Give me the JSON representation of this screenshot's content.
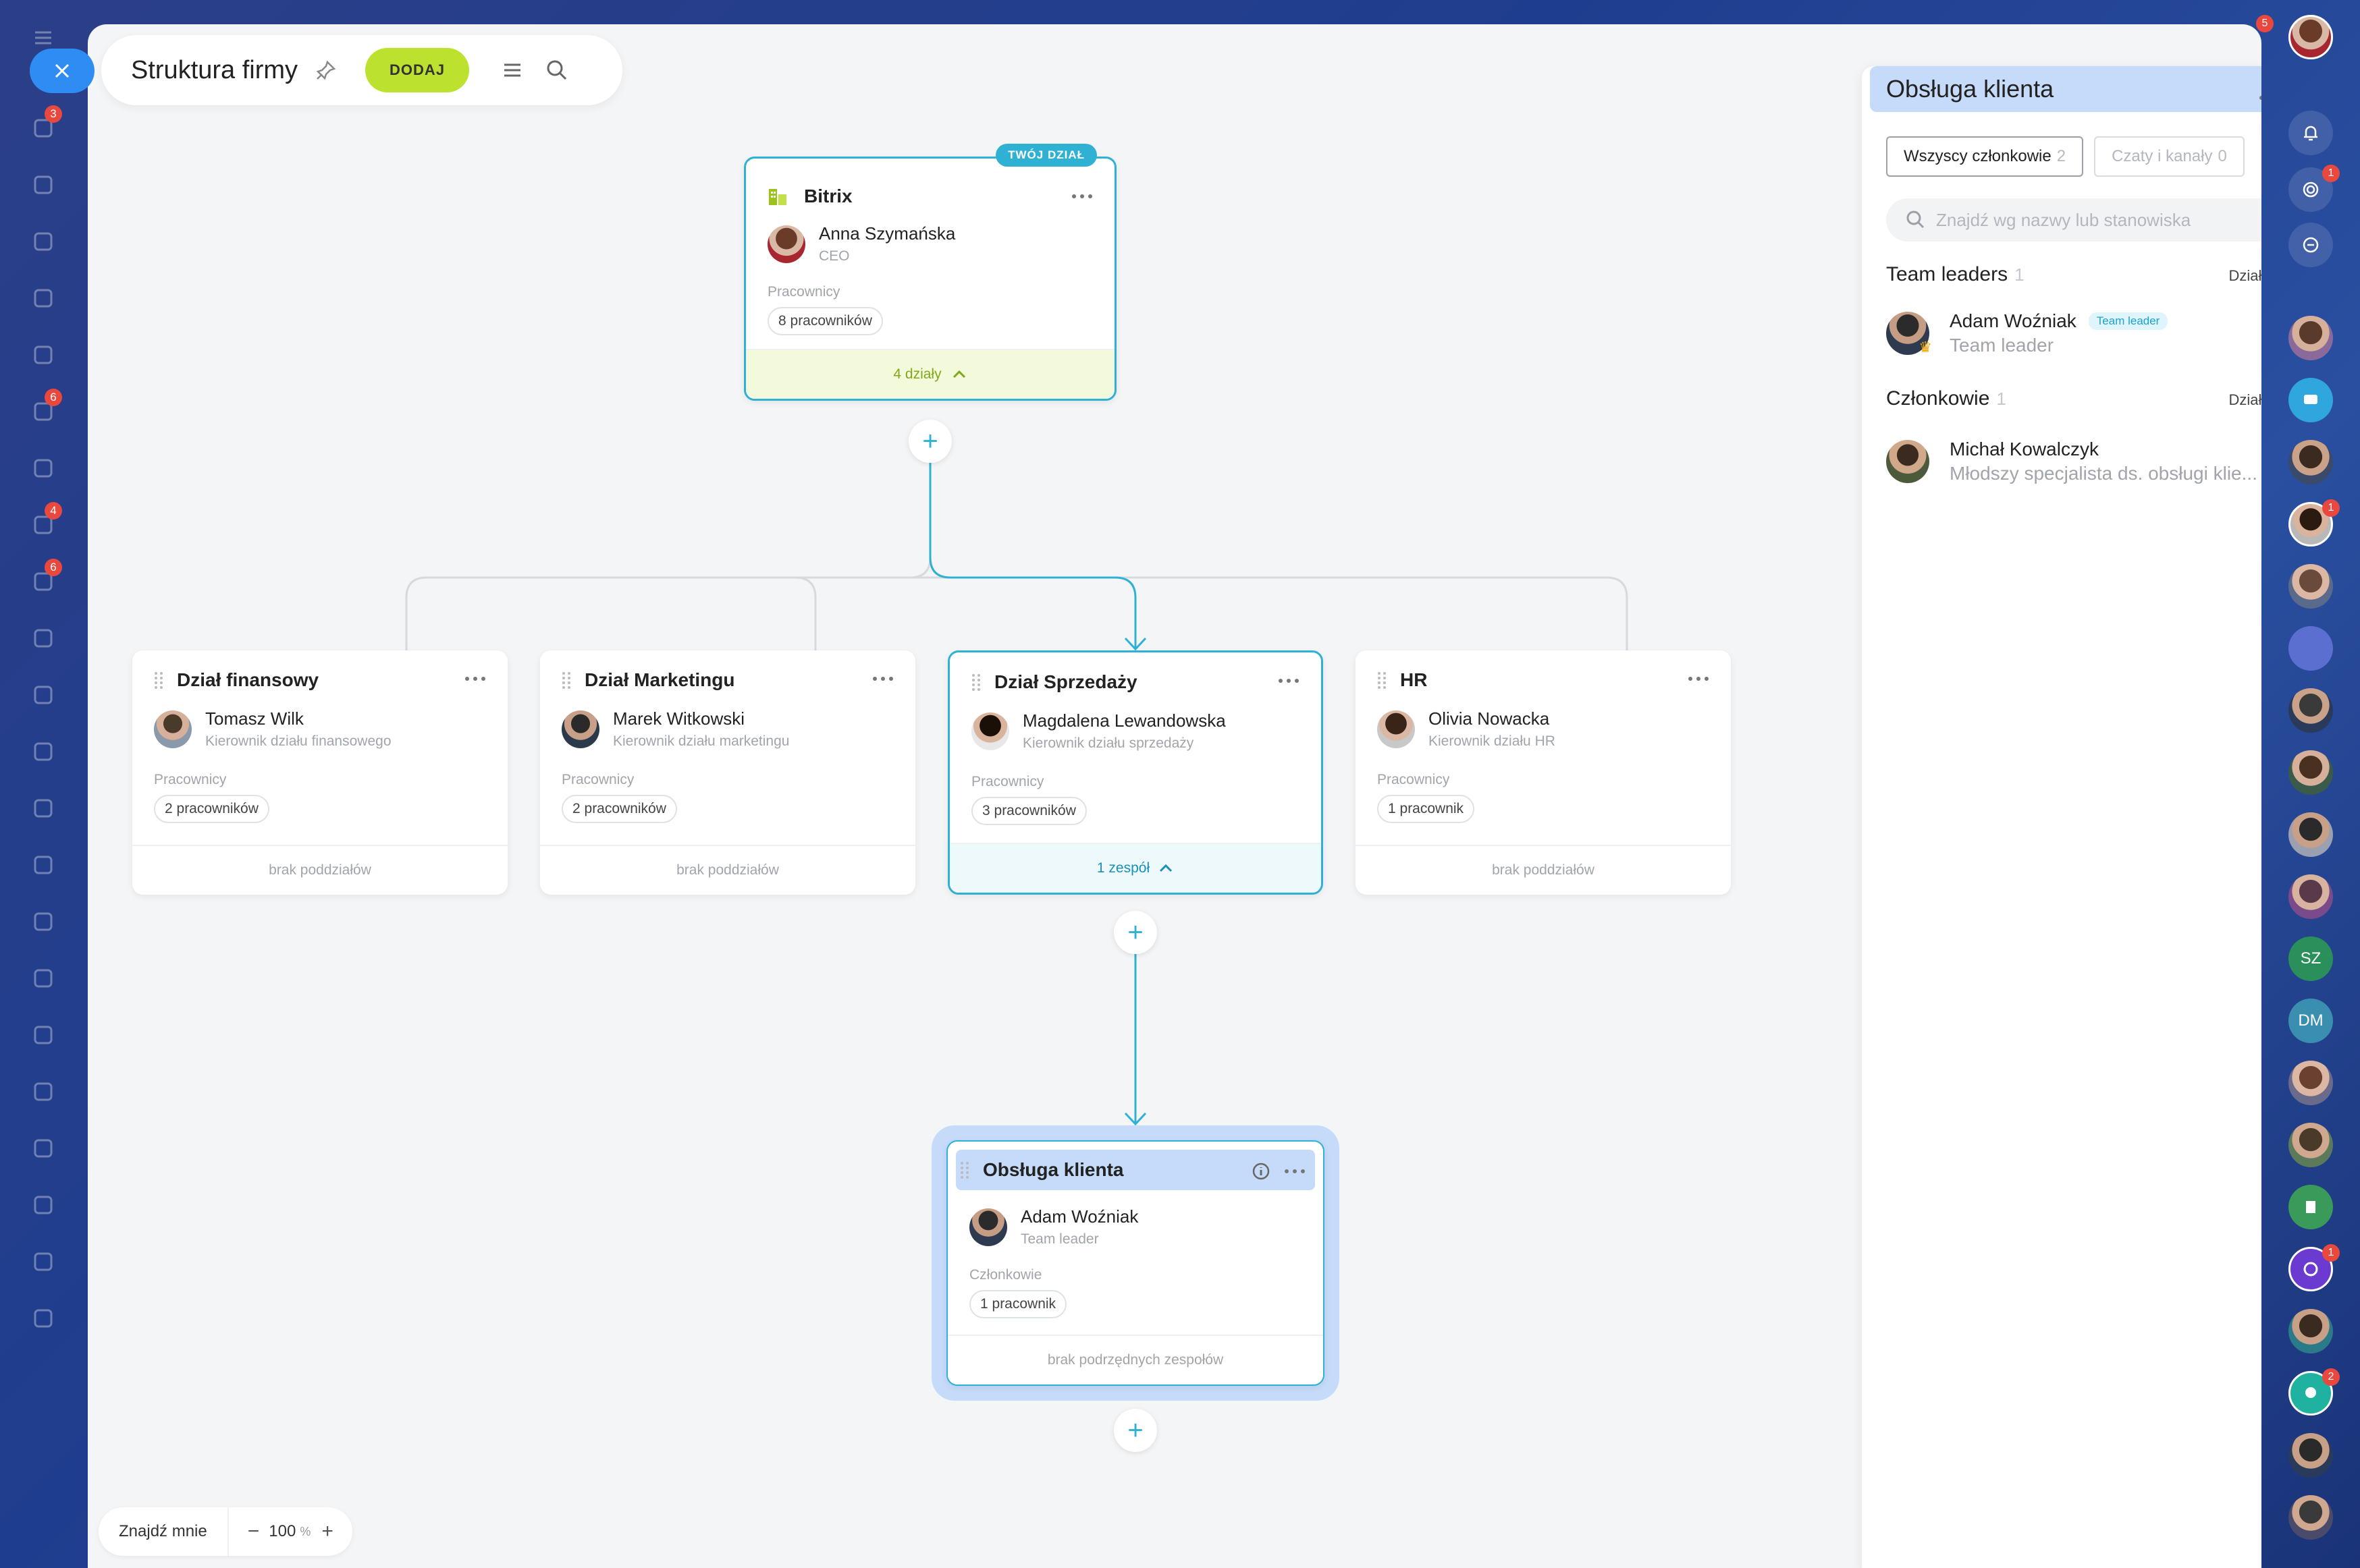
{
  "header": {
    "title": "Struktura firmy",
    "add_label": "DODAJ"
  },
  "left_sidebar": {
    "items": [
      {
        "icon": "filter-icon",
        "badge": "3"
      },
      {
        "icon": "calendar-icon",
        "badge": ""
      },
      {
        "icon": "drive-icon",
        "badge": ""
      },
      {
        "icon": "target-icon",
        "badge": ""
      },
      {
        "icon": "cart-icon",
        "badge": ""
      },
      {
        "icon": "tasks-icon",
        "badge": "6"
      },
      {
        "icon": "loop-icon",
        "badge": ""
      },
      {
        "icon": "chat-icon",
        "badge": "4"
      },
      {
        "icon": "docs-icon",
        "badge": "6"
      },
      {
        "icon": "settings-icon",
        "badge": ""
      },
      {
        "icon": "calendar2-icon",
        "badge": ""
      },
      {
        "icon": "board-icon",
        "badge": ""
      },
      {
        "icon": "file-icon",
        "badge": ""
      },
      {
        "icon": "monitor-icon",
        "badge": ""
      },
      {
        "icon": "card-icon",
        "badge": ""
      },
      {
        "icon": "mail-icon",
        "badge": ""
      },
      {
        "icon": "group-icon",
        "badge": ""
      },
      {
        "icon": "chart-icon",
        "badge": ""
      },
      {
        "icon": "flask-icon",
        "badge": ""
      },
      {
        "icon": "market-icon",
        "badge": ""
      },
      {
        "icon": "automation-icon",
        "badge": ""
      },
      {
        "icon": "code-icon",
        "badge": ""
      }
    ]
  },
  "root": {
    "badge": "TWÓJ DZIAŁ",
    "name": "Bitrix",
    "head_name": "Anna Szymańska",
    "head_role": "CEO",
    "employees_label": "Pracownicy",
    "employees": "8 pracowników",
    "sub_label": "4 działy"
  },
  "departments": [
    {
      "name": "Dział finansowy",
      "head_name": "Tomasz Wilk",
      "head_role": "Kierownik działu finansowego",
      "employees_label": "Pracownicy",
      "employees": "2 pracowników",
      "foot": "brak poddziałów"
    },
    {
      "name": "Dział Marketingu",
      "head_name": "Marek Witkowski",
      "head_role": "Kierownik działu marketingu",
      "employees_label": "Pracownicy",
      "employees": "2 pracowników",
      "foot": "brak poddziałów"
    },
    {
      "name": "Dział Sprzedaży",
      "head_name": "Magdalena Lewandowska",
      "head_role": "Kierownik działu sprzedaży",
      "employees_label": "Pracownicy",
      "employees": "3 pracowników",
      "foot": "1 zespół"
    },
    {
      "name": "HR",
      "head_name": "Olivia Nowacka",
      "head_role": "Kierownik działu HR",
      "employees_label": "Pracownicy",
      "employees": "1 pracownik",
      "foot": "brak poddziałów"
    }
  ],
  "team": {
    "name": "Obsługa klienta",
    "head_name": "Adam Woźniak",
    "head_role": "Team leader",
    "members_label": "Członkowie",
    "members": "1 pracownik",
    "foot": "brak podrzędnych zespołów"
  },
  "panel": {
    "title": "Obsługa klienta",
    "tab_all": "Wszyscy członkowie",
    "tab_all_count": "2",
    "tab_chats": "Czaty i kanały",
    "tab_chats_count": "0",
    "search_placeholder": "Znajdź wg nazwy lub stanowiska",
    "leaders_label": "Team leaders",
    "leaders_count": "1",
    "actions_label": "Działania",
    "leader": {
      "name": "Adam Woźniak",
      "badge": "Team leader",
      "role": "Team leader"
    },
    "members_label": "Członkowie",
    "members_count": "1",
    "member": {
      "name": "Michał Kowalczyk",
      "role": "Młodszy specjalista ds. obsługi klie..."
    }
  },
  "bottom": {
    "find_me": "Znajdź mnie",
    "zoom": "100",
    "zoom_unit": "%"
  },
  "right_sidebar": {
    "top_badge": "5",
    "initials_1": "SZ",
    "initials_2": "DM",
    "badges": [
      "1",
      "1",
      "1",
      "2"
    ]
  },
  "colors": {
    "accent": "#2fb1d4",
    "add_button": "#bce22f",
    "selected": "#c5dbf9",
    "badge": "#e8483d"
  }
}
